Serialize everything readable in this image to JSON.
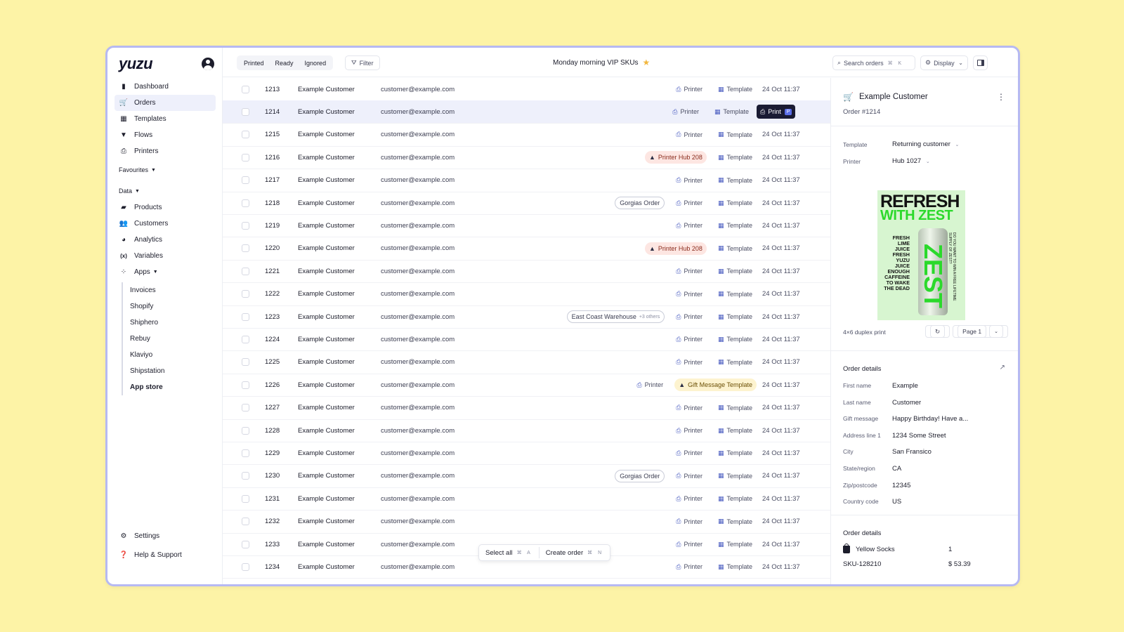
{
  "app": {
    "logo": "yuzu",
    "view_title": "Monday morning VIP SKUs"
  },
  "sidebar": {
    "main": [
      {
        "label": "Dashboard",
        "icon": "bar-chart-icon"
      },
      {
        "label": "Orders",
        "icon": "cart-icon"
      },
      {
        "label": "Templates",
        "icon": "template-icon"
      },
      {
        "label": "Flows",
        "icon": "funnel-icon"
      },
      {
        "label": "Printers",
        "icon": "printer-icon"
      }
    ],
    "favourites_label": "Favourites",
    "data_label": "Data",
    "data_items": [
      {
        "label": "Products",
        "icon": "bag-icon"
      },
      {
        "label": "Customers",
        "icon": "users-icon"
      },
      {
        "label": "Analytics",
        "icon": "pie-chart-icon"
      },
      {
        "label": "Variables",
        "icon": "variable-icon"
      },
      {
        "label": "Apps",
        "icon": "apps-icon"
      }
    ],
    "apps": [
      "Invoices",
      "Shopify",
      "Shiphero",
      "Rebuy",
      "Klaviyo",
      "Shipstation",
      "App store"
    ],
    "settings": "Settings",
    "help": "Help & Support"
  },
  "toolbar": {
    "segments": [
      "Printed",
      "Ready",
      "Ignored"
    ],
    "filter": "Filter",
    "search": "Search orders",
    "search_kbd": "⌘ K",
    "display": "Display"
  },
  "orders": [
    {
      "id": "1213",
      "name": "Example Customer",
      "email": "customer@example.com",
      "printer": "Printer",
      "template": "Template",
      "date": "24 Oct 11:37"
    },
    {
      "id": "1214",
      "name": "Example Customer",
      "email": "customer@example.com",
      "printer": "Printer",
      "template": "Template",
      "date": "",
      "print_button": "Print",
      "print_kbd": "P",
      "selected": true
    },
    {
      "id": "1215",
      "name": "Example Customer",
      "email": "customer@example.com",
      "printer": "Printer",
      "template": "Template",
      "date": "24 Oct 11:37"
    },
    {
      "id": "1216",
      "name": "Example Customer",
      "email": "customer@example.com",
      "printer": "Printer Hub 208",
      "printer_warn": true,
      "template": "Template",
      "date": "24 Oct 11:37"
    },
    {
      "id": "1217",
      "name": "Example Customer",
      "email": "customer@example.com",
      "printer": "Printer",
      "template": "Template",
      "date": "24 Oct 11:37"
    },
    {
      "id": "1218",
      "name": "Example Customer",
      "email": "customer@example.com",
      "tag": "Gorgias Order",
      "printer": "Printer",
      "template": "Template",
      "date": "24 Oct 11:37"
    },
    {
      "id": "1219",
      "name": "Example Customer",
      "email": "customer@example.com",
      "printer": "Printer",
      "template": "Template",
      "date": "24 Oct 11:37"
    },
    {
      "id": "1220",
      "name": "Example Customer",
      "email": "customer@example.com",
      "printer": "Printer Hub 208",
      "printer_warn": true,
      "template": "Template",
      "date": "24 Oct 11:37"
    },
    {
      "id": "1221",
      "name": "Example Customer",
      "email": "customer@example.com",
      "printer": "Printer",
      "template": "Template",
      "date": "24 Oct 11:37"
    },
    {
      "id": "1222",
      "name": "Example Customer",
      "email": "customer@example.com",
      "printer": "Printer",
      "template": "Template",
      "date": "24 Oct 11:37"
    },
    {
      "id": "1223",
      "name": "Example Customer",
      "email": "customer@example.com",
      "tag": "East Coast Warehouse",
      "tag_extra": "+3 others",
      "printer": "Printer",
      "template": "Template",
      "date": "24 Oct 11:37"
    },
    {
      "id": "1224",
      "name": "Example Customer",
      "email": "customer@example.com",
      "printer": "Printer",
      "template": "Template",
      "date": "24 Oct 11:37"
    },
    {
      "id": "1225",
      "name": "Example Customer",
      "email": "customer@example.com",
      "printer": "Printer",
      "template": "Template",
      "date": "24 Oct 11:37"
    },
    {
      "id": "1226",
      "name": "Example Customer",
      "email": "customer@example.com",
      "printer": "Printer",
      "template": "Gift Message Template",
      "template_warn": true,
      "date": "24 Oct 11:37"
    },
    {
      "id": "1227",
      "name": "Example Customer",
      "email": "customer@example.com",
      "printer": "Printer",
      "template": "Template",
      "date": "24 Oct 11:37"
    },
    {
      "id": "1228",
      "name": "Example Customer",
      "email": "customer@example.com",
      "printer": "Printer",
      "template": "Template",
      "date": "24 Oct 11:37"
    },
    {
      "id": "1229",
      "name": "Example Customer",
      "email": "customer@example.com",
      "printer": "Printer",
      "template": "Template",
      "date": "24 Oct 11:37"
    },
    {
      "id": "1230",
      "name": "Example Customer",
      "email": "customer@example.com",
      "tag": "Gorgias Order",
      "printer": "Printer",
      "template": "Template",
      "date": "24 Oct 11:37"
    },
    {
      "id": "1231",
      "name": "Example Customer",
      "email": "customer@example.com",
      "printer": "Printer",
      "template": "Template",
      "date": "24 Oct 11:37"
    },
    {
      "id": "1232",
      "name": "Example Customer",
      "email": "customer@example.com",
      "printer": "Printer",
      "template": "Template",
      "date": "24 Oct 11:37"
    },
    {
      "id": "1233",
      "name": "Example Customer",
      "email": "customer@example.com",
      "printer": "Printer",
      "template": "Template",
      "date": "24 Oct 11:37"
    },
    {
      "id": "1234",
      "name": "Example Customer",
      "email": "customer@example.com",
      "printer": "Printer",
      "template": "Template",
      "date": "24 Oct 11:37"
    }
  ],
  "actions": {
    "select_all": "Select all",
    "select_all_kbd": "⌘ A",
    "create_order": "Create order",
    "create_order_kbd": "⌘ N"
  },
  "panel": {
    "customer": "Example Customer",
    "order_number": "Order #1214",
    "template_label": "Template",
    "template_value": "Returning customer",
    "printer_label": "Printer",
    "printer_value": "Hub 1027",
    "poster": {
      "line1": "REFRESH",
      "line2": "WITH ZEST",
      "copy": "FRESH LIME JUICE FRESH YUZU JUICE ENOUGH CAFFEINE TO WAKE THE DEAD",
      "can_brand": "ZEST",
      "side_text": "DO YOU WANT TO WIN A FREE LIFETIME SUPPLY OF ZEST?"
    },
    "print_format": "4×6 duplex print",
    "page": "Page 1",
    "order_details_title": "Order details",
    "details": [
      {
        "label": "First name",
        "value": "Example"
      },
      {
        "label": "Last name",
        "value": "Customer"
      },
      {
        "label": "Gift message",
        "value": "Happy Birthday! Have a..."
      },
      {
        "label": "Address line 1",
        "value": "1234 Some Street"
      },
      {
        "label": "City",
        "value": "San Fransico"
      },
      {
        "label": "State/region",
        "value": "CA"
      },
      {
        "label": "Zip/postcode",
        "value": "12345"
      },
      {
        "label": "Country code",
        "value": "US"
      }
    ],
    "items_title": "Order details",
    "item": {
      "name": "Yellow Socks",
      "qty": "1",
      "sku": "SKU-128210",
      "price": "$ 53.39"
    }
  },
  "colors": {
    "background": "#fdf3a6",
    "window_border": "#b6b9f2",
    "accent": "#4a5cc0",
    "selected_row": "#eef0fb",
    "warn_red": "#fde6e2",
    "warn_yellow": "#fdf3cf"
  }
}
